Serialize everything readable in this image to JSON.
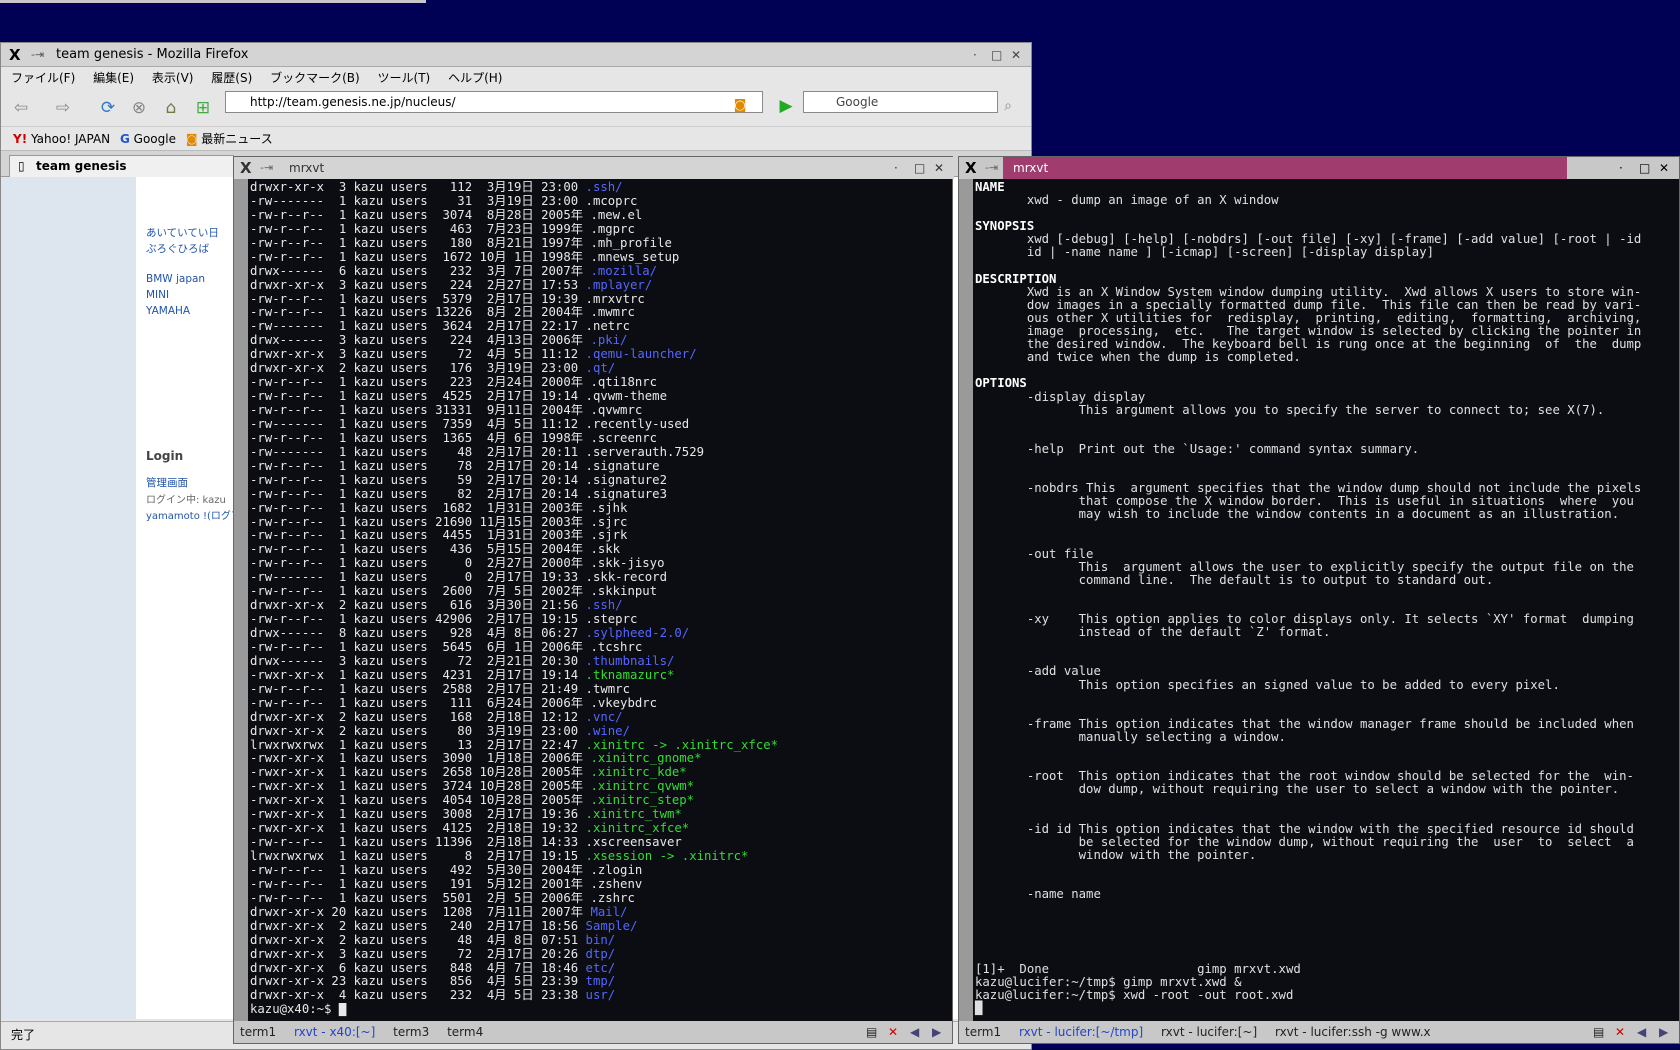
{
  "firefox": {
    "window_title": "team genesis - Mozilla Firefox",
    "menu": [
      "ファイル(F)",
      "編集(E)",
      "表示(V)",
      "履歴(S)",
      "ブックマーク(B)",
      "ツール(T)",
      "ヘルプ(H)"
    ],
    "url": "http://team.genesis.ne.jp/nucleus/",
    "search_placeholder": "Google",
    "bookmarks": [
      "Yahoo! JAPAN",
      "Google",
      "最新ニュース"
    ],
    "tab": "team genesis",
    "sidebar_links": [
      "あいていてい日",
      "ぶろぐひろば",
      "BMW japan",
      "MINI",
      "YAMAHA"
    ],
    "login_heading": "Login",
    "admin_link": "管理画面",
    "login_status": "ログイン中: kazu",
    "login_user": "yamamoto !(ログア",
    "status": "完了"
  },
  "term1": {
    "title": "mrxvt",
    "lines": [
      [
        "drwxr-xr-x",
        "3",
        "112",
        "3月",
        "19日",
        "23:00",
        ".ssh/"
      ],
      [
        "-rw-------",
        "1",
        "31",
        "3月",
        "19日",
        "23:00",
        ".mcoprc"
      ],
      [
        "-rw-r--r--",
        "1",
        "3074",
        "8月",
        "28日",
        "2005年",
        ".mew.el"
      ],
      [
        "-rw-r--r--",
        "1",
        "463",
        "7月",
        "23日",
        "1999年",
        ".mgprc"
      ],
      [
        "-rw-r--r--",
        "1",
        "180",
        "8月",
        "21日",
        "1997年",
        ".mh_profile"
      ],
      [
        "-rw-r--r--",
        "1",
        "1672",
        "10月",
        "1日",
        "1998年",
        ".mnews_setup"
      ],
      [
        "drwx------",
        "6",
        "232",
        "3月",
        "7日",
        "2007年",
        ".mozilla/"
      ],
      [
        "drwxr-xr-x",
        "3",
        "224",
        "2月",
        "27日",
        "17:53",
        ".mplayer/"
      ],
      [
        "-rw-r--r--",
        "1",
        "5379",
        "2月",
        "17日",
        "19:39",
        ".mrxvtrc"
      ],
      [
        "-rw-r--r--",
        "1",
        "13226",
        "8月",
        "2日",
        "2004年",
        ".mwmrc"
      ],
      [
        "-rw-------",
        "1",
        "3624",
        "2月",
        "17日",
        "22:17",
        ".netrc"
      ],
      [
        "drwx------",
        "3",
        "224",
        "4月",
        "13日",
        "2006年",
        ".pki/"
      ],
      [
        "drwxr-xr-x",
        "3",
        "72",
        "4月",
        "5日",
        "11:12",
        ".qemu-launcher/"
      ],
      [
        "drwxr-xr-x",
        "2",
        "176",
        "3月",
        "19日",
        "23:00",
        ".qt/"
      ],
      [
        "-rw-r--r--",
        "1",
        "223",
        "2月",
        "24日",
        "2000年",
        ".qti18nrc"
      ],
      [
        "-rw-r--r--",
        "1",
        "4525",
        "2月",
        "17日",
        "19:14",
        ".qvwm-theme"
      ],
      [
        "-rw-r--r--",
        "1",
        "31331",
        "9月",
        "11日",
        "2004年",
        ".qvwmrc"
      ],
      [
        "-rw-------",
        "1",
        "7359",
        "4月",
        "5日",
        "11:12",
        ".recently-used"
      ],
      [
        "-rw-r--r--",
        "1",
        "1365",
        "4月",
        "6日",
        "1998年",
        ".screenrc"
      ],
      [
        "-rw-------",
        "1",
        "48",
        "2月",
        "17日",
        "20:11",
        ".serverauth.7529"
      ],
      [
        "-rw-r--r--",
        "1",
        "78",
        "2月",
        "17日",
        "20:14",
        ".signature"
      ],
      [
        "-rw-r--r--",
        "1",
        "59",
        "2月",
        "17日",
        "20:14",
        ".signature2"
      ],
      [
        "-rw-r--r--",
        "1",
        "82",
        "2月",
        "17日",
        "20:14",
        ".signature3"
      ],
      [
        "-rw-r--r--",
        "1",
        "1682",
        "1月",
        "31日",
        "2003年",
        ".sjhk"
      ],
      [
        "-rw-r--r--",
        "1",
        "21690",
        "11月",
        "15日",
        "2003年",
        ".sjrc"
      ],
      [
        "-rw-r--r--",
        "1",
        "4455",
        "1月",
        "31日",
        "2003年",
        ".sjrk"
      ],
      [
        "-rw-r--r--",
        "1",
        "436",
        "5月",
        "15日",
        "2004年",
        ".skk"
      ],
      [
        "-rw-r--r--",
        "1",
        "0",
        "2月",
        "27日",
        "2000年",
        ".skk-jisyo"
      ],
      [
        "-rw-------",
        "1",
        "0",
        "2月",
        "17日",
        "19:33",
        ".skk-record"
      ],
      [
        "-rw-r--r--",
        "1",
        "2600",
        "7月",
        "5日",
        "2002年",
        ".skkinput"
      ],
      [
        "drwxr-xr-x",
        "2",
        "616",
        "3月",
        "30日",
        "21:56",
        ".ssh/"
      ],
      [
        "-rw-r--r--",
        "1",
        "42906",
        "2月",
        "17日",
        "19:15",
        ".steprc"
      ],
      [
        "drwx------",
        "8",
        "928",
        "4月",
        "8日",
        "06:27",
        ".sylpheed-2.0/"
      ],
      [
        "-rw-r--r--",
        "1",
        "5645",
        "6月",
        "1日",
        "2006年",
        ".tcshrc"
      ],
      [
        "drwx------",
        "3",
        "72",
        "2月",
        "21日",
        "20:30",
        ".thumbnails/"
      ],
      [
        "-rwxr-xr-x",
        "1",
        "4231",
        "2月",
        "17日",
        "19:14",
        ".tknamazurc*"
      ],
      [
        "-rw-r--r--",
        "1",
        "2588",
        "2月",
        "17日",
        "21:49",
        ".twmrc"
      ],
      [
        "-rw-r--r--",
        "1",
        "111",
        "6月",
        "24日",
        "2006年",
        ".vkeybdrc"
      ],
      [
        "drwxr-xr-x",
        "2",
        "168",
        "2月",
        "18日",
        "12:12",
        ".vnc/"
      ],
      [
        "drwxr-xr-x",
        "2",
        "80",
        "3月",
        "19日",
        "23:00",
        ".wine/"
      ],
      [
        "lrwxrwxrwx",
        "1",
        "13",
        "2月",
        "17日",
        "22:47",
        ".xinitrc -> .xinitrc_xfce*"
      ],
      [
        "-rwxr-xr-x",
        "1",
        "3090",
        "1月",
        "18日",
        "2006年",
        ".xinitrc_gnome*"
      ],
      [
        "-rwxr-xr-x",
        "1",
        "2658",
        "10月",
        "28日",
        "2005年",
        ".xinitrc_kde*"
      ],
      [
        "-rwxr-xr-x",
        "1",
        "3724",
        "10月",
        "28日",
        "2005年",
        ".xinitrc_qvwm*"
      ],
      [
        "-rwxr-xr-x",
        "1",
        "4054",
        "10月",
        "28日",
        "2005年",
        ".xinitrc_step*"
      ],
      [
        "-rwxr-xr-x",
        "1",
        "3008",
        "2月",
        "17日",
        "19:36",
        ".xinitrc_twm*"
      ],
      [
        "-rwxr-xr-x",
        "1",
        "4125",
        "2月",
        "18日",
        "19:32",
        ".xinitrc_xfce*"
      ],
      [
        "-rw-r--r--",
        "1",
        "11396",
        "2月",
        "18日",
        "14:33",
        ".xscreensaver"
      ],
      [
        "lrwxrwxrwx",
        "1",
        "8",
        "2月",
        "17日",
        "19:15",
        ".xsession -> .xinitrc*"
      ],
      [
        "-rw-r--r--",
        "1",
        "492",
        "5月",
        "30日",
        "2004年",
        ".zlogin"
      ],
      [
        "-rw-r--r--",
        "1",
        "191",
        "5月",
        "12日",
        "2001年",
        ".zshenv"
      ],
      [
        "-rw-r--r--",
        "1",
        "5501",
        "2月",
        "5日",
        "2006年",
        ".zshrc"
      ],
      [
        "drwxr-xr-x",
        "20",
        "1208",
        "7月",
        "11日",
        "2007年",
        "Mail/"
      ],
      [
        "drwxr-xr-x",
        "2",
        "240",
        "2月",
        "17日",
        "18:56",
        "Sample/"
      ],
      [
        "drwxr-xr-x",
        "2",
        "48",
        "4月",
        "8日",
        "07:51",
        "bin/"
      ],
      [
        "drwxr-xr-x",
        "3",
        "72",
        "2月",
        "17日",
        "20:26",
        "dtp/"
      ],
      [
        "drwxr-xr-x",
        "6",
        "848",
        "4月",
        "7日",
        "18:46",
        "etc/"
      ],
      [
        "drwxr-xr-x",
        "23",
        "856",
        "4月",
        "5日",
        "23:39",
        "tmp/"
      ],
      [
        "drwxr-xr-x",
        "4",
        "232",
        "4月",
        "5日",
        "23:38",
        "usr/"
      ]
    ],
    "owner": "kazu",
    "group": "users",
    "prompt": "kazu@x40:~$ ",
    "tabs": [
      "term1",
      "rxvt - x40:[~]",
      "term3",
      "term4"
    ]
  },
  "term2": {
    "title": "mrxvt",
    "man": [
      {
        "t": "NAME",
        "k": "h"
      },
      {
        "t": "       xwd - dump an image of an X window"
      },
      {
        "t": ""
      },
      {
        "t": "SYNOPSIS",
        "k": "h"
      },
      {
        "t": "       xwd [-debug] [-help] [-nobdrs] [-out file] [-xy] [-frame] [-add value] [-root | -id"
      },
      {
        "t": "       id | -name name ] [-icmap] [-screen] [-display display]"
      },
      {
        "t": ""
      },
      {
        "t": "DESCRIPTION",
        "k": "h"
      },
      {
        "t": "       Xwd is an X Window System window dumping utility.  Xwd allows X users to store win-"
      },
      {
        "t": "       dow images in a specially formatted dump file.  This file can then be read by vari-"
      },
      {
        "t": "       ous other X utilities for  redisplay,  printing,  editing,  formatting,  archiving,"
      },
      {
        "t": "       image  processing,  etc.   The target window is selected by clicking the pointer in"
      },
      {
        "t": "       the desired window.  The keyboard bell is rung once at the beginning  of  the  dump"
      },
      {
        "t": "       and twice when the dump is completed."
      },
      {
        "t": ""
      },
      {
        "t": "OPTIONS",
        "k": "h"
      },
      {
        "t": "       -display display"
      },
      {
        "t": "              This argument allows you to specify the server to connect to; see X(7)."
      },
      {
        "t": ""
      },
      {
        "t": ""
      },
      {
        "t": "       -help  Print out the `Usage:' command syntax summary."
      },
      {
        "t": ""
      },
      {
        "t": ""
      },
      {
        "t": "       -nobdrs This  argument specifies that the window dump should not include the pixels"
      },
      {
        "t": "              that compose the X window border.  This is useful in situations  where  you"
      },
      {
        "t": "              may wish to include the window contents in a document as an illustration."
      },
      {
        "t": ""
      },
      {
        "t": ""
      },
      {
        "t": "       -out file"
      },
      {
        "t": "              This  argument allows the user to explicitly specify the output file on the"
      },
      {
        "t": "              command line.  The default is to output to standard out."
      },
      {
        "t": ""
      },
      {
        "t": ""
      },
      {
        "t": "       -xy    This option applies to color displays only. It selects `XY' format  dumping"
      },
      {
        "t": "              instead of the default `Z' format."
      },
      {
        "t": ""
      },
      {
        "t": ""
      },
      {
        "t": "       -add value"
      },
      {
        "t": "              This option specifies an signed value to be added to every pixel."
      },
      {
        "t": ""
      },
      {
        "t": ""
      },
      {
        "t": "       -frame This option indicates that the window manager frame should be included when"
      },
      {
        "t": "              manually selecting a window."
      },
      {
        "t": ""
      },
      {
        "t": ""
      },
      {
        "t": "       -root  This option indicates that the root window should be selected for the  win-"
      },
      {
        "t": "              dow dump, without requiring the user to select a window with the pointer."
      },
      {
        "t": ""
      },
      {
        "t": ""
      },
      {
        "t": "       -id id This option indicates that the window with the specified resource id should"
      },
      {
        "t": "              be selected for the window dump, without requiring the  user  to  select  a"
      },
      {
        "t": "              window with the pointer."
      },
      {
        "t": ""
      },
      {
        "t": ""
      },
      {
        "t": "       -name name"
      }
    ],
    "shell": [
      "[1]+  Done                    gimp mrxvt.xwd",
      "kazu@lucifer:~/tmp$ gimp mrxvt.xwd &",
      "kazu@lucifer:~/tmp$ xwd -root -out root.xwd"
    ],
    "tabs": [
      "term1",
      "rxvt - lucifer:[~/tmp]",
      "rxvt - lucifer:[~]",
      "rxvt - lucifer:ssh -g www.x"
    ]
  }
}
